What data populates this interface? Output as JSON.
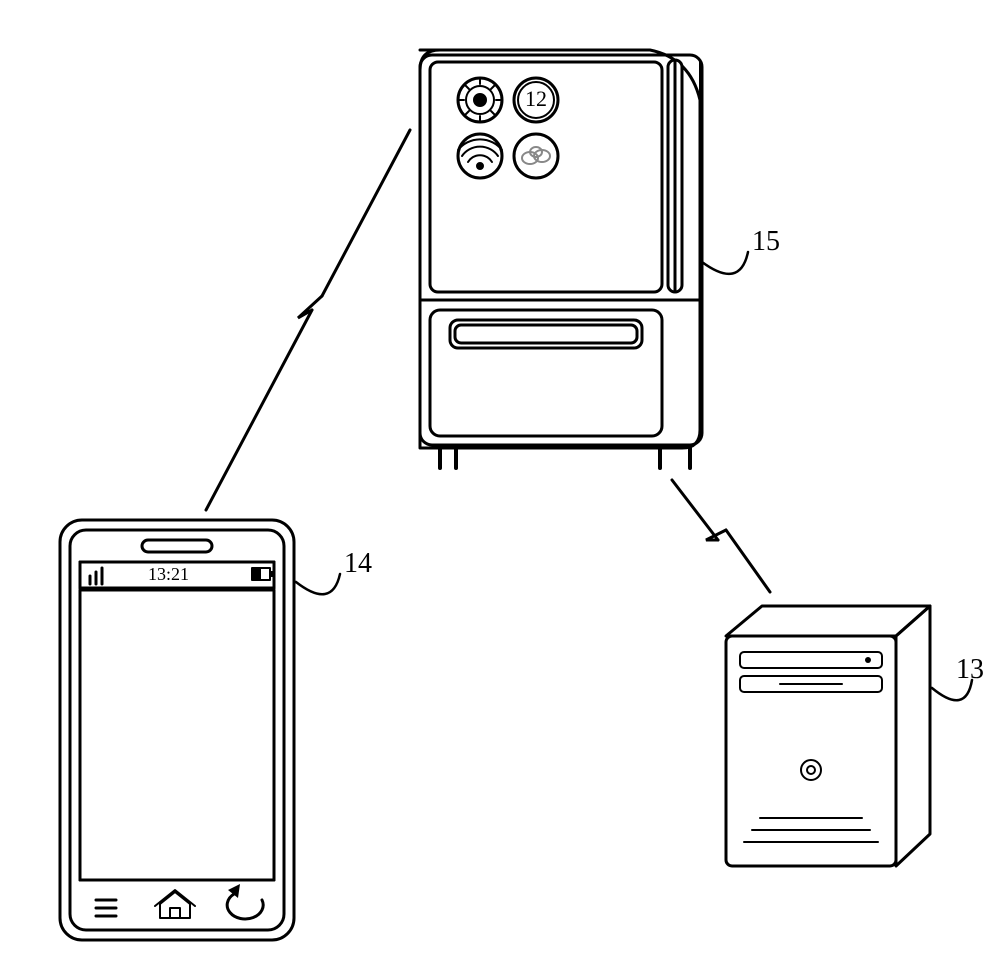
{
  "labels": {
    "server": "13",
    "phone": "14",
    "fridge": "15"
  },
  "phone": {
    "time": "13:21"
  },
  "fridge": {
    "magnet_number": "12"
  }
}
